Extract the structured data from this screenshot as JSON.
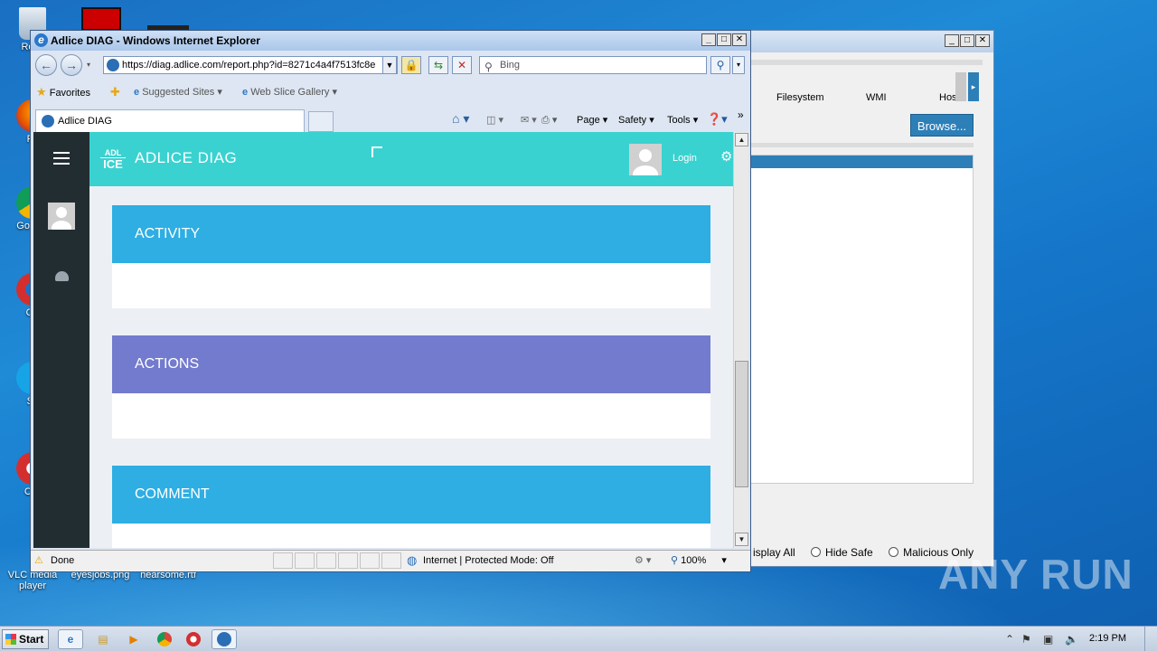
{
  "desktop": {
    "icons": [
      {
        "label": "Recy",
        "name": "recycle-bin"
      },
      {
        "label": "Fir",
        "name": "firefox"
      },
      {
        "label": "Go Chr",
        "name": "chrome"
      },
      {
        "label": "Op",
        "name": "opera"
      },
      {
        "label": "Sk",
        "name": "skype"
      },
      {
        "label": "CCl",
        "name": "ccleaner"
      },
      {
        "label": "VLC media player",
        "name": "vlc"
      },
      {
        "label": "eyesjobs.png",
        "name": "eyesjobs-file"
      },
      {
        "label": "hearsome.rtf",
        "name": "hearsome-file"
      }
    ],
    "watermark": "ANY RUN"
  },
  "bg_window": {
    "tabs": [
      "Filesystem",
      "WMI",
      "Hos"
    ],
    "browse_label": "Browse...",
    "radios": [
      "isplay All",
      "Hide Safe",
      "Malicious Only"
    ]
  },
  "ie": {
    "title": "Adlice DIAG - Windows Internet Explorer",
    "address": "https://diag.adlice.com/report.php?id=8271c4a4f7513fc8e",
    "address_domain": "diag.adlice.com",
    "search_placeholder": "Bing",
    "favorites": {
      "favorites_label": "Favorites",
      "suggested_label": "Suggested Sites",
      "webslice_label": "Web Slice Gallery"
    },
    "tab_title": "Adlice DIAG",
    "commands": [
      "Page",
      "Safety",
      "Tools"
    ],
    "status": {
      "left": "Done",
      "zone": "Internet | Protected Mode: Off",
      "zoom": "100%"
    }
  },
  "app": {
    "logo_top": "ADL",
    "logo_bottom": "ICE",
    "brand": "ADLICE DIAG",
    "login_label": "Login",
    "sections": [
      {
        "title": "ACTIVITY",
        "color": "#2eaee2"
      },
      {
        "title": "ACTIONS",
        "color": "#737bce"
      },
      {
        "title": "COMMENT",
        "color": "#2eaee2"
      }
    ]
  },
  "taskbar": {
    "start_label": "Start",
    "clock": "2:19 PM"
  }
}
